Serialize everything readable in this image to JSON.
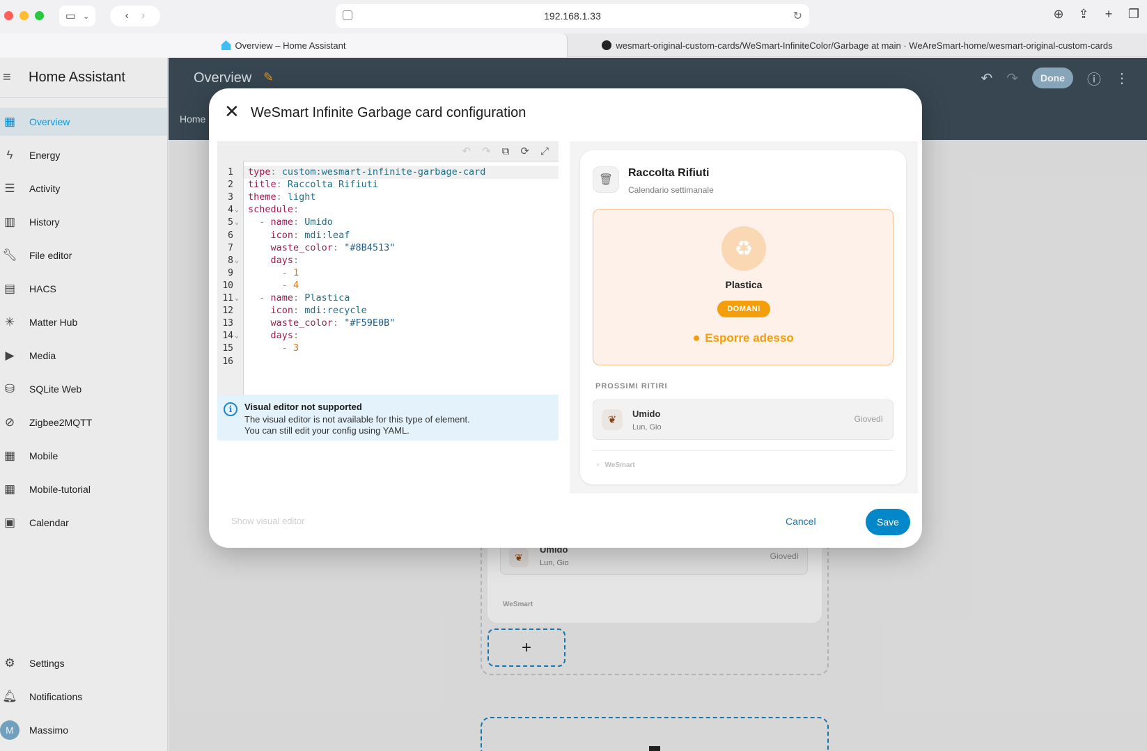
{
  "browser": {
    "address": "192.168.1.33",
    "tabs": [
      {
        "label": "Overview – Home Assistant"
      },
      {
        "label": "wesmart-original-custom-cards/WeSmart-InfiniteColor/Garbage at main · WeAreSmart-home/wesmart-original-custom-cards"
      }
    ]
  },
  "sidebar": {
    "title": "Home Assistant",
    "items": [
      {
        "label": "Overview",
        "icon": "dashboard-icon",
        "active": true
      },
      {
        "label": "Energy",
        "icon": "lightning-icon"
      },
      {
        "label": "Activity",
        "icon": "list-icon"
      },
      {
        "label": "History",
        "icon": "chart-icon"
      },
      {
        "label": "File editor",
        "icon": "wrench-icon"
      },
      {
        "label": "HACS",
        "icon": "hacs-icon"
      },
      {
        "label": "Matter Hub",
        "icon": "hub-icon"
      },
      {
        "label": "Media",
        "icon": "media-icon"
      },
      {
        "label": "SQLite Web",
        "icon": "database-icon"
      },
      {
        "label": "Zigbee2MQTT",
        "icon": "zigbee-icon"
      },
      {
        "label": "Mobile",
        "icon": "dashboard-icon"
      },
      {
        "label": "Mobile-tutorial",
        "icon": "dashboard-icon"
      },
      {
        "label": "Calendar",
        "icon": "calendar-icon"
      }
    ],
    "bottom": {
      "settings": "Settings",
      "notifications": "Notifications",
      "user": "Massimo",
      "user_initial": "M"
    }
  },
  "header": {
    "title": "Overview",
    "view_tab": "Home",
    "done": "Done"
  },
  "background_card": {
    "row_name": "Umido",
    "row_days": "Lun, Gio",
    "row_when": "Giovedì",
    "brand": "WeSmart",
    "add": "+"
  },
  "dialog": {
    "title": "WeSmart Infinite Garbage card configuration",
    "code_lines": [
      {
        "ln": "1",
        "indent": "",
        "key": "type",
        "value": "custom:wesmart-infinite-garbage-card",
        "vtype": "v"
      },
      {
        "ln": "2",
        "indent": "",
        "key": "title",
        "value": "Raccolta Rifiuti",
        "vtype": "v"
      },
      {
        "ln": "3",
        "indent": "",
        "key": "theme",
        "value": "light",
        "vtype": "v"
      },
      {
        "ln": "4",
        "indent": "",
        "key": "schedule",
        "value": "",
        "vtype": "v",
        "fold": true
      },
      {
        "ln": "5",
        "indent": "  - ",
        "key": "name",
        "value": "Umido",
        "vtype": "v",
        "fold": true
      },
      {
        "ln": "6",
        "indent": "    ",
        "key": "icon",
        "value": "mdi:leaf",
        "vtype": "v"
      },
      {
        "ln": "7",
        "indent": "    ",
        "key": "waste_color",
        "value": "\"#8B4513\"",
        "vtype": "s"
      },
      {
        "ln": "8",
        "indent": "    ",
        "key": "days",
        "value": "",
        "vtype": "v",
        "fold": true
      },
      {
        "ln": "9",
        "indent": "      - ",
        "key": "",
        "value": "1",
        "vtype": "n"
      },
      {
        "ln": "10",
        "indent": "      - ",
        "key": "",
        "value": "4",
        "vtype": "n"
      },
      {
        "ln": "11",
        "indent": "  - ",
        "key": "name",
        "value": "Plastica",
        "vtype": "v",
        "fold": true
      },
      {
        "ln": "12",
        "indent": "    ",
        "key": "icon",
        "value": "mdi:recycle",
        "vtype": "v"
      },
      {
        "ln": "13",
        "indent": "    ",
        "key": "waste_color",
        "value": "\"#F59E0B\"",
        "vtype": "s"
      },
      {
        "ln": "14",
        "indent": "    ",
        "key": "days",
        "value": "",
        "vtype": "v",
        "fold": true
      },
      {
        "ln": "15",
        "indent": "      - ",
        "key": "",
        "value": "3",
        "vtype": "n"
      },
      {
        "ln": "16",
        "indent": "",
        "key": "",
        "value": "",
        "vtype": "v"
      }
    ],
    "info": {
      "title": "Visual editor not supported",
      "line1": "The visual editor is not available for this type of element.",
      "line2": "You can still edit your config using YAML."
    },
    "show_visual": "Show visual editor",
    "cancel": "Cancel",
    "save": "Save"
  },
  "preview": {
    "title": "Raccolta Rifiuti",
    "subtitle": "Calendario settimanale",
    "hero_name": "Plastica",
    "hero_badge": "DOMANI",
    "hero_status": "Esporre adesso",
    "hero_color": "#F59E0B",
    "section_label": "PROSSIMI RITIRI",
    "next": {
      "name": "Umido",
      "days": "Lun, Gio",
      "when": "Giovedì",
      "color": "#8B4513"
    },
    "brand": "WeSmart"
  }
}
